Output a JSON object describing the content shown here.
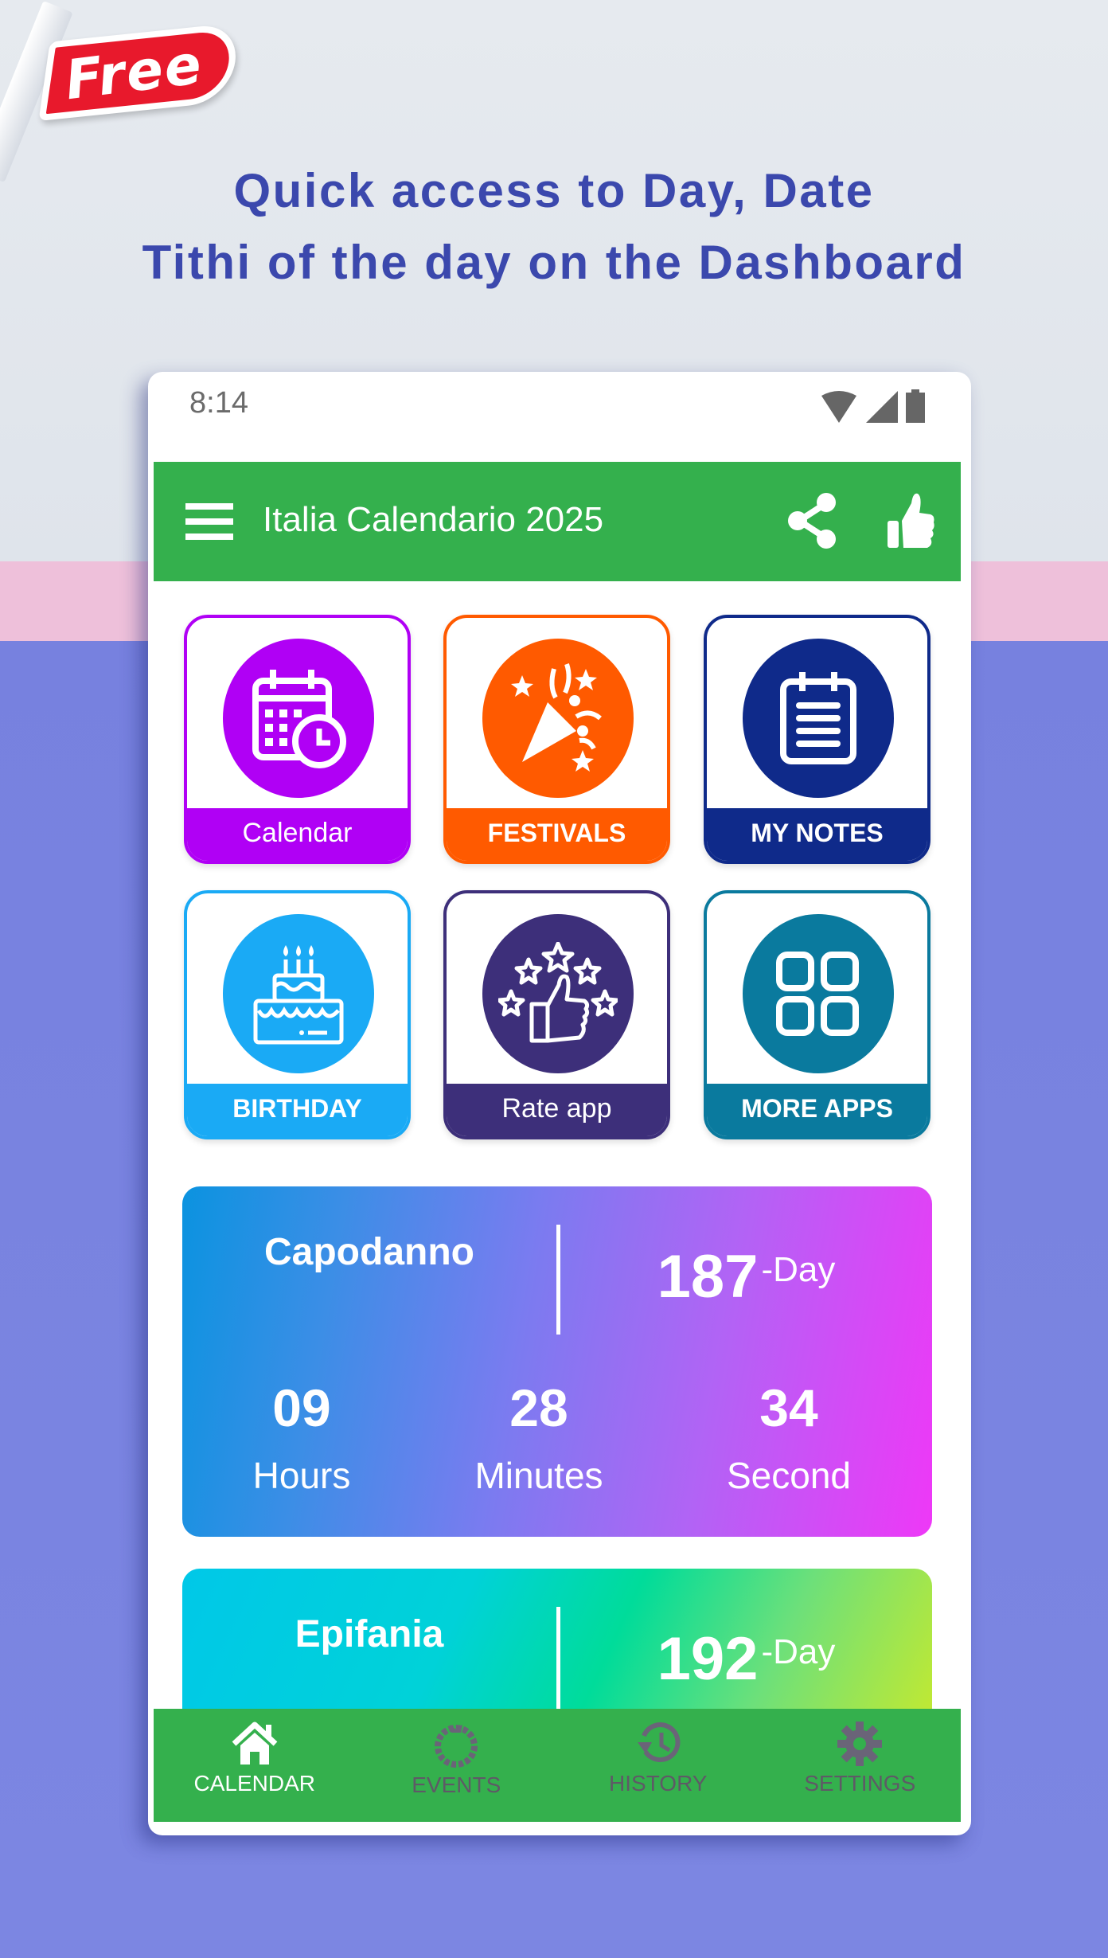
{
  "promo": {
    "badge": "Free",
    "headline_line1": "Quick access to Day, Date",
    "headline_line2": "Tithi of the day on the Dashboard"
  },
  "status_bar": {
    "time": "8:14",
    "icons": [
      "wifi-icon",
      "signal-icon",
      "battery-icon"
    ]
  },
  "app_bar": {
    "title": "Italia Calendario 2025",
    "actions": [
      "share-icon",
      "like-icon"
    ],
    "color": "#34b04d"
  },
  "grid": [
    {
      "label": "Calendar",
      "icon": "calendar-clock-icon",
      "color": "#b000f5"
    },
    {
      "label": "FESTIVALS",
      "icon": "party-popper-icon",
      "color": "#ff5a00"
    },
    {
      "label": "MY NOTES",
      "icon": "notepad-icon",
      "color": "#0f2a8a"
    },
    {
      "label": "BIRTHDAY",
      "icon": "birthday-cake-icon",
      "color": "#1aaaf5"
    },
    {
      "label": "Rate app",
      "icon": "thumbs-up-stars-icon",
      "color": "#3d2f7a"
    },
    {
      "label": "MORE APPS",
      "icon": "apps-grid-icon",
      "color": "#0a7a9e"
    }
  ],
  "countdowns": [
    {
      "name": "Capodanno",
      "days": "187",
      "days_suffix": "-Day",
      "hours": "09",
      "hours_label": "Hours",
      "minutes": "28",
      "minutes_label": "Minutes",
      "seconds": "34",
      "seconds_label": "Second"
    },
    {
      "name": "Epifania",
      "days": "192",
      "days_suffix": "-Day"
    }
  ],
  "bottom_nav": [
    {
      "label": "CALENDAR",
      "icon": "home-icon",
      "active": true
    },
    {
      "label": "EVENTS",
      "icon": "wreath-icon",
      "active": false
    },
    {
      "label": "HISTORY",
      "icon": "history-icon",
      "active": false
    },
    {
      "label": "SETTINGS",
      "icon": "gear-icon",
      "active": false
    }
  ]
}
